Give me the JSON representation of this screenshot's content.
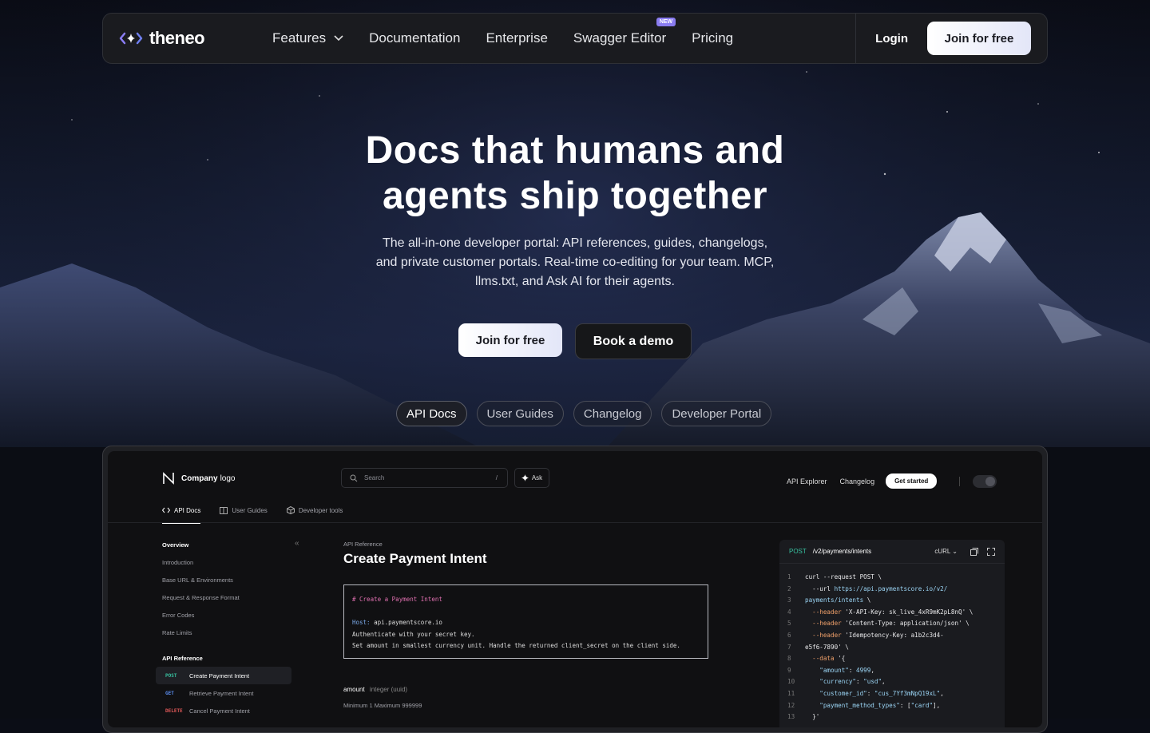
{
  "nav": {
    "brand": "theneo",
    "links": [
      "Features",
      "Documentation",
      "Enterprise",
      "Swagger Editor",
      "Pricing"
    ],
    "new_badge": "NEW",
    "login": "Login",
    "join": "Join for free"
  },
  "hero": {
    "title_line1": "Docs that humans and",
    "title_line2": "agents ship together",
    "subtitle": "The all-in-one developer portal: API references, guides, changelogs, and private customer portals. Real-time co-editing for your team. MCP, llms.txt, and Ask AI for their agents.",
    "cta_primary": "Join for free",
    "cta_secondary": "Book a demo"
  },
  "tabs": [
    "API Docs",
    "User Guides",
    "Changelog",
    "Developer Portal"
  ],
  "preview": {
    "logo_bold": "Company",
    "logo_light": "logo",
    "search_placeholder": "Search",
    "search_kbd": "/",
    "ask": "Ask",
    "top_links": [
      "API Explorer",
      "Changelog"
    ],
    "get_started": "Get started",
    "doc_tabs": [
      "API Docs",
      "User Guides",
      "Developer tools"
    ],
    "sidebar": {
      "overview": "Overview",
      "items": [
        "Introduction",
        "Base URL & Environments",
        "Request & Response Format",
        "Error Codes",
        "Rate Limits"
      ],
      "api_ref": "API Reference",
      "endpoints": [
        {
          "method": "POST",
          "label": "Create Payment Intent",
          "color": "#38c1a0"
        },
        {
          "method": "GET",
          "label": "Retrieve Payment Intent",
          "color": "#5b8def"
        },
        {
          "method": "DELETE",
          "label": "Cancel Payment Intent",
          "color": "#e05858"
        }
      ]
    },
    "main": {
      "crumb": "API Reference",
      "title": "Create Payment Intent",
      "code_comment": "# Create a Payment Intent",
      "code_host_key": "Host:",
      "code_host_val": " api.paymentscore.io",
      "code_line3": "Authenticate with your secret key.",
      "code_line4": "Set amount in smallest currency unit. Handle the returned client_secret on the client side.",
      "field_name": "amount",
      "field_type": "integer (uuid)",
      "field_constraints": "Minimum 1 Maximum 999999"
    },
    "panel": {
      "method": "POST",
      "path": "/v2/payments/intents",
      "lang": "cURL",
      "lines": [
        {
          "n": "1",
          "parts": [
            [
              "ct",
              "curl --request POST \\"
            ]
          ]
        },
        {
          "n": "2",
          "parts": [
            [
              "ct",
              "  --url "
            ],
            [
              "str",
              "https://api.paymentscore.io/v2/"
            ]
          ]
        },
        {
          "n": "3",
          "parts": [
            [
              "str",
              "payments/intents"
            ],
            [
              "ct",
              " \\"
            ]
          ]
        },
        {
          "n": "4",
          "parts": [
            [
              "fl",
              "  --header"
            ],
            [
              "ct",
              " 'X-API-Key: sk_live_4xR9mK2pL8nQ' \\"
            ]
          ]
        },
        {
          "n": "5",
          "parts": [
            [
              "fl",
              "  --header"
            ],
            [
              "ct",
              " 'Content-Type: application/json' \\"
            ]
          ]
        },
        {
          "n": "6",
          "parts": [
            [
              "fl",
              "  --header"
            ],
            [
              "ct",
              " 'Idempotency-Key: a1b2c3d4-"
            ]
          ]
        },
        {
          "n": "7",
          "parts": [
            [
              "ct",
              "e5f6-7890' \\"
            ]
          ]
        },
        {
          "n": "8",
          "parts": [
            [
              "fl",
              "  --data"
            ],
            [
              "ct",
              " '{"
            ]
          ]
        },
        {
          "n": "9",
          "parts": [
            [
              "str",
              "    \"amount\""
            ],
            [
              "ct",
              ": "
            ],
            [
              "str",
              "4999"
            ],
            [
              "ct",
              ","
            ]
          ]
        },
        {
          "n": "10",
          "parts": [
            [
              "str",
              "    \"currency\""
            ],
            [
              "ct",
              ": "
            ],
            [
              "str",
              "\"usd\""
            ],
            [
              "ct",
              ","
            ]
          ]
        },
        {
          "n": "11",
          "parts": [
            [
              "str",
              "    \"customer_id\""
            ],
            [
              "ct",
              ": "
            ],
            [
              "str",
              "\"cus_7Yf3mNpQ19xL\""
            ],
            [
              "ct",
              ","
            ]
          ]
        },
        {
          "n": "12",
          "parts": [
            [
              "str",
              "    \"payment_method_types\""
            ],
            [
              "ct",
              ": ["
            ],
            [
              "str",
              "\"card\""
            ],
            [
              "ct",
              "],"
            ]
          ]
        },
        {
          "n": "13",
          "parts": [
            [
              "ct",
              "  }'"
            ]
          ]
        }
      ]
    }
  }
}
